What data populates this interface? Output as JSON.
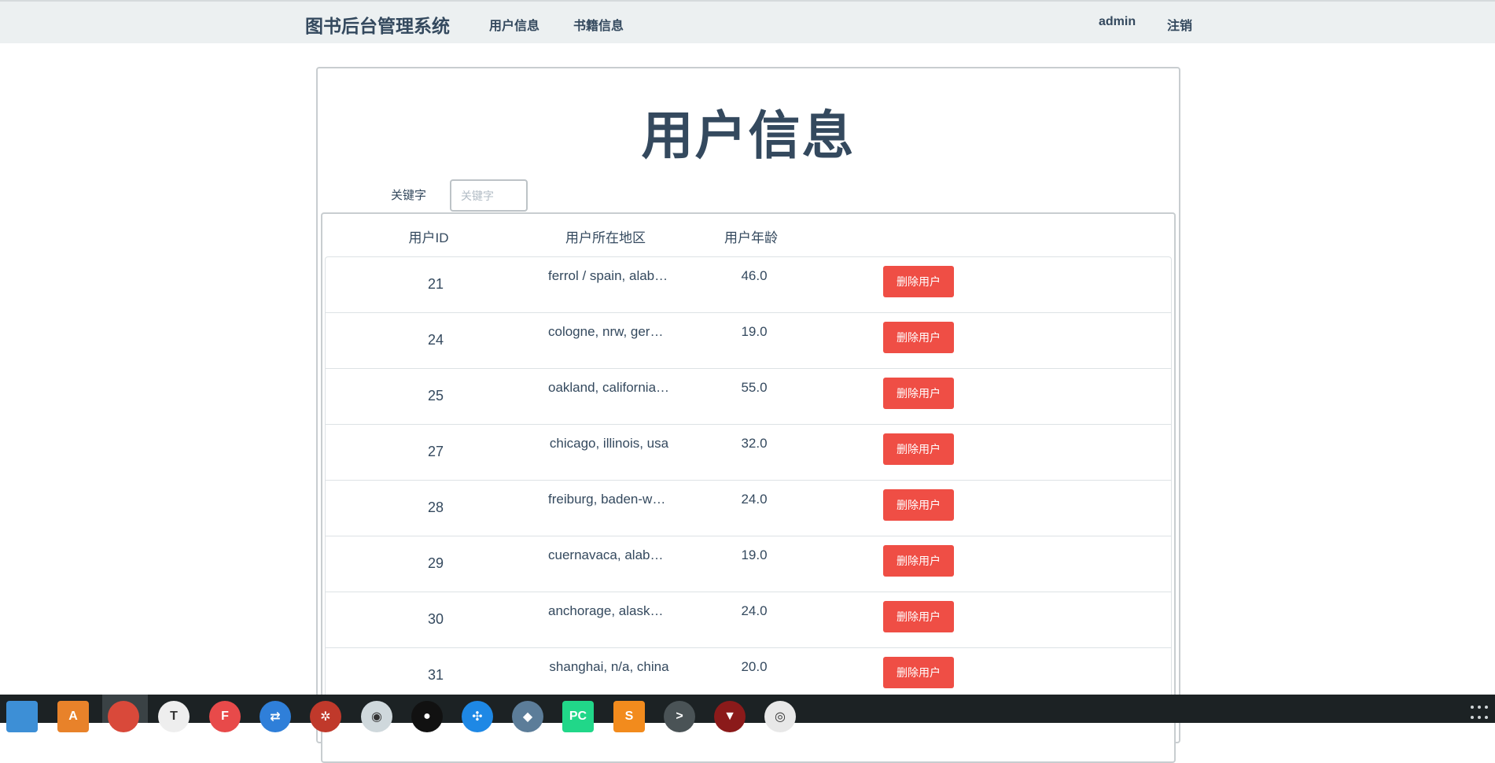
{
  "nav": {
    "brand": "图书后台管理系统",
    "users_link": "用户信息",
    "books_link": "书籍信息",
    "username": "admin",
    "logout": "注销"
  },
  "main": {
    "title": "用户信息",
    "search": {
      "label": "关键字",
      "placeholder": "关键字",
      "value": ""
    },
    "table": {
      "headers": [
        "用户ID",
        "用户所在地区",
        "用户年龄"
      ],
      "delete_label": "删除用户",
      "rows": [
        {
          "id": "21",
          "location": "ferrol / spain, alabama, spain",
          "age": "46.0"
        },
        {
          "id": "24",
          "location": "cologne, nrw, germany",
          "age": "19.0"
        },
        {
          "id": "25",
          "location": "oakland, california, usa",
          "age": "55.0"
        },
        {
          "id": "27",
          "location": "chicago, illinois, usa",
          "age": "32.0"
        },
        {
          "id": "28",
          "location": "freiburg, baden-wuerttemberg, germany",
          "age": "24.0"
        },
        {
          "id": "29",
          "location": "cuernavaca, alabama, mexico",
          "age": "19.0"
        },
        {
          "id": "30",
          "location": "anchorage, alaska, usa",
          "age": "24.0"
        },
        {
          "id": "31",
          "location": "shanghai, n/a, china",
          "age": "20.0"
        }
      ]
    }
  },
  "taskbar": {
    "apps": [
      {
        "name": "files-icon",
        "glyph": "",
        "color": "#3d8fd6"
      },
      {
        "name": "software-center-icon",
        "glyph": "A",
        "color": "#e8822a"
      },
      {
        "name": "chrome-icon",
        "glyph": "",
        "color": "#d9493a"
      },
      {
        "name": "typora-icon",
        "glyph": "T",
        "color": "#eeeeee"
      },
      {
        "name": "foxit-icon",
        "glyph": "F",
        "color": "#e84a4a"
      },
      {
        "name": "teamviewer-icon",
        "glyph": "⇄",
        "color": "#2f7fd9"
      },
      {
        "name": "spider-icon",
        "glyph": "✲",
        "color": "#c0392b"
      },
      {
        "name": "wechat-icon",
        "glyph": "◉",
        "color": "#cfd8dc"
      },
      {
        "name": "qq-icon",
        "glyph": "●",
        "color": "#111111"
      },
      {
        "name": "network-icon",
        "glyph": "✣",
        "color": "#1e88e5"
      },
      {
        "name": "mysql-icon",
        "glyph": "◆",
        "color": "#5c7d99"
      },
      {
        "name": "pycharm-icon",
        "glyph": "PC",
        "color": "#21d789"
      },
      {
        "name": "sublime-icon",
        "glyph": "S",
        "color": "#f28b1d"
      },
      {
        "name": "terminal-icon",
        "glyph": ">",
        "color": "#4a5356"
      },
      {
        "name": "wine-icon",
        "glyph": "▼",
        "color": "#8b1a1a"
      },
      {
        "name": "robot-icon",
        "glyph": "◎",
        "color": "#e8e8e8"
      }
    ]
  }
}
